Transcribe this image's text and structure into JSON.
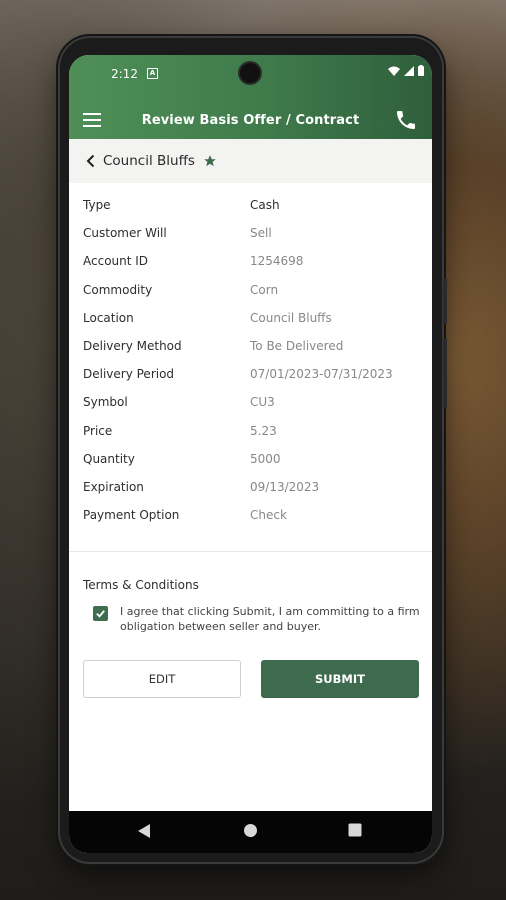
{
  "status_bar": {
    "time": "2:12"
  },
  "header": {
    "title": "Review Basis Offer / Contract"
  },
  "subheader": {
    "location": "Council Bluffs"
  },
  "details": [
    {
      "label": "Type",
      "value": "Cash"
    },
    {
      "label": "Customer Will",
      "value": "Sell"
    },
    {
      "label": "Account ID",
      "value": "1254698"
    },
    {
      "label": "Commodity",
      "value": "Corn"
    },
    {
      "label": "Location",
      "value": "Council Bluffs"
    },
    {
      "label": "Delivery Method",
      "value": "To Be Delivered"
    },
    {
      "label": "Delivery Period",
      "value": "07/01/2023-07/31/2023"
    },
    {
      "label": "Symbol",
      "value": "CU3"
    },
    {
      "label": "Price",
      "value": "5.23"
    },
    {
      "label": "Quantity",
      "value": "5000"
    },
    {
      "label": "Expiration",
      "value": "09/13/2023"
    },
    {
      "label": "Payment Option",
      "value": "Check"
    }
  ],
  "terms": {
    "title": "Terms & Conditions",
    "agreement": "I agree that clicking Submit, I am committing to a firm obligation between seller and buyer.",
    "checked": true
  },
  "actions": {
    "edit_label": "EDIT",
    "submit_label": "SUBMIT"
  },
  "colors": {
    "brand_green": "#3e6b4e",
    "header_gradient_start": "#4f8f57",
    "header_gradient_end": "#2f5f3c"
  },
  "icons": [
    "menu-icon",
    "phone-icon",
    "chevron-left-icon",
    "star-icon",
    "check-icon",
    "wifi-icon",
    "signal-icon",
    "battery-icon",
    "nav-back-icon",
    "nav-home-icon",
    "nav-recents-icon"
  ]
}
